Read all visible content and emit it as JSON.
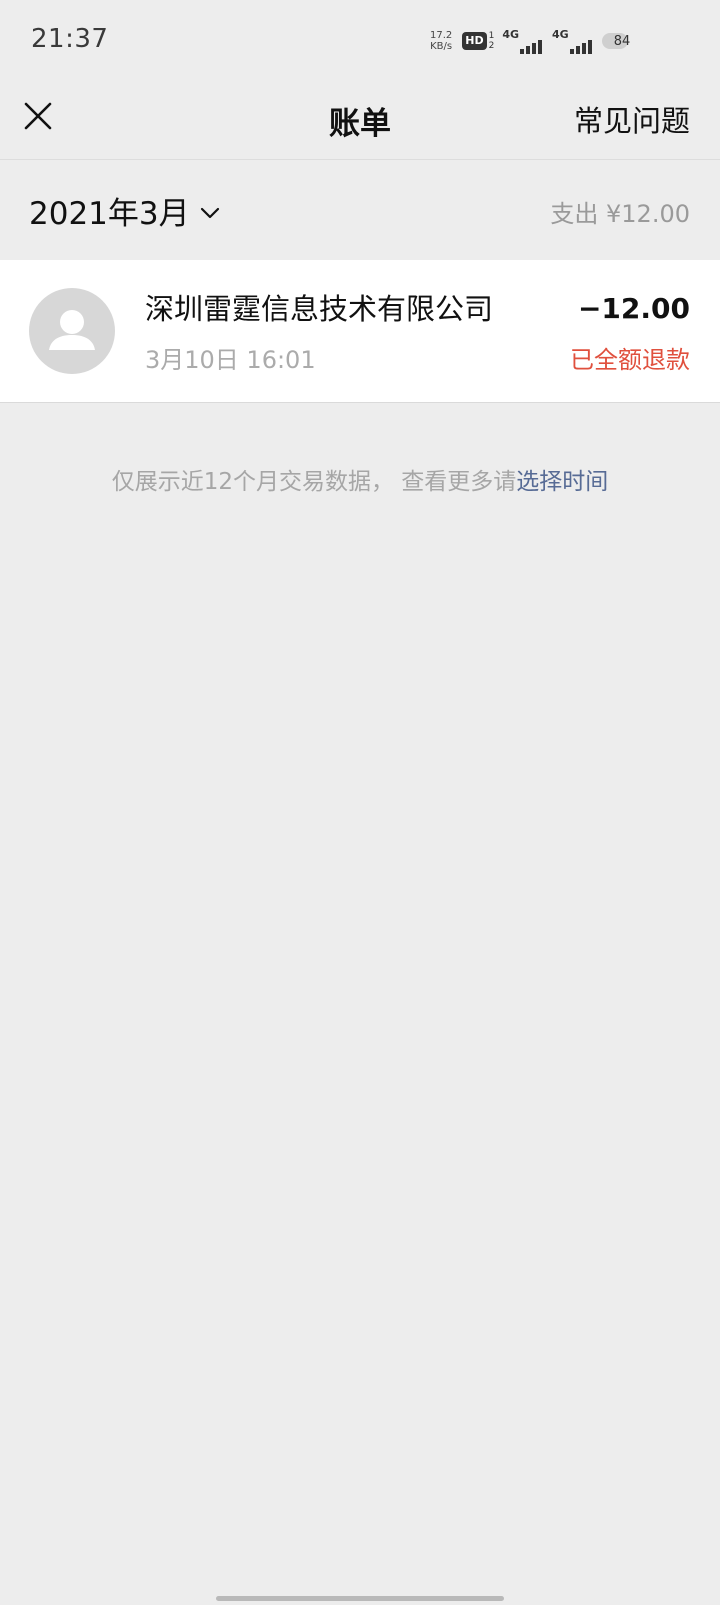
{
  "status_bar": {
    "time": "21:37",
    "net_speed_value": "17.2",
    "net_speed_unit": "KB/s",
    "hd_label": "HD",
    "hd_sup": "1",
    "hd_sub": "2",
    "signal_1_label": "4G",
    "signal_2_label": "4G",
    "battery_level": "84"
  },
  "nav": {
    "close_icon": "close-icon",
    "title": "账单",
    "faq_label": "常见问题"
  },
  "month_bar": {
    "month_label": "2021年3月",
    "chevron_icon": "chevron-down-icon",
    "expense_summary": "支出 ¥12.00"
  },
  "bills": [
    {
      "avatar_icon": "user-avatar-icon",
      "merchant": "深圳雷霆信息技术有限公司",
      "time": "3月10日 16:01",
      "amount": "−12.00",
      "status": "已全额退款"
    }
  ],
  "notice": {
    "text": "仅展示近12个月交易数据， 查看更多请",
    "link": "选择时间"
  },
  "colors": {
    "background": "#EDEDED",
    "card": "#FFFFFF",
    "refund_red": "#E0503E",
    "link_blue": "#576B95",
    "secondary_text": "#A6A6A6"
  }
}
